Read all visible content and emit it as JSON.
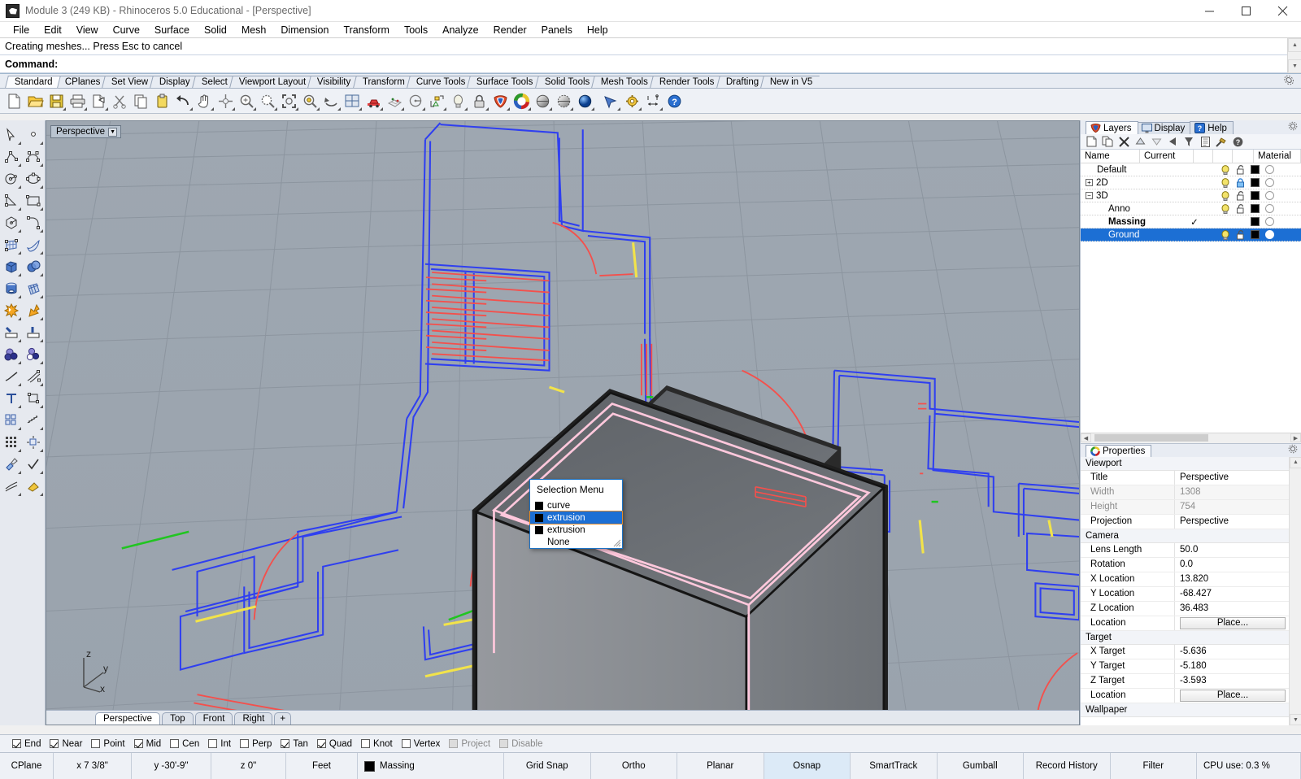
{
  "window": {
    "title": "Module 3 (249 KB) - Rhinoceros 5.0 Educational - [Perspective]",
    "minimize": "–",
    "maximize": "□",
    "close": "✕"
  },
  "menubar": [
    "File",
    "Edit",
    "View",
    "Curve",
    "Surface",
    "Solid",
    "Mesh",
    "Dimension",
    "Transform",
    "Tools",
    "Analyze",
    "Render",
    "Panels",
    "Help"
  ],
  "command": {
    "history": "Creating meshes... Press Esc to cancel",
    "prompt": "Command:"
  },
  "toolbar_tabs": [
    {
      "label": "Standard",
      "active": true
    },
    {
      "label": "CPlanes",
      "active": false
    },
    {
      "label": "Set View",
      "active": false
    },
    {
      "label": "Display",
      "active": false
    },
    {
      "label": "Select",
      "active": false
    },
    {
      "label": "Viewport Layout",
      "active": false
    },
    {
      "label": "Visibility",
      "active": false
    },
    {
      "label": "Transform",
      "active": false
    },
    {
      "label": "Curve Tools",
      "active": false
    },
    {
      "label": "Surface Tools",
      "active": false
    },
    {
      "label": "Solid Tools",
      "active": false
    },
    {
      "label": "Mesh Tools",
      "active": false
    },
    {
      "label": "Render Tools",
      "active": false
    },
    {
      "label": "Drafting",
      "active": false
    },
    {
      "label": "New in V5",
      "active": false
    }
  ],
  "viewport": {
    "label": "Perspective",
    "tabs": [
      {
        "label": "Perspective",
        "active": true
      },
      {
        "label": "Top",
        "active": false
      },
      {
        "label": "Front",
        "active": false
      },
      {
        "label": "Right",
        "active": false
      }
    ],
    "add_tab": "+",
    "axis": {
      "x": "x",
      "y": "y",
      "z": "z"
    }
  },
  "selection_menu": {
    "title": "Selection Menu",
    "items": [
      {
        "label": "curve",
        "selected": false,
        "swatch": true
      },
      {
        "label": "extrusion",
        "selected": true,
        "swatch": true
      },
      {
        "label": "extrusion",
        "selected": false,
        "swatch": true
      },
      {
        "label": "None",
        "selected": false,
        "swatch": false
      }
    ]
  },
  "panels": {
    "tabs": [
      {
        "label": "Layers",
        "active": true,
        "icon": "rhino-layers-icon"
      },
      {
        "label": "Display",
        "active": false,
        "icon": "monitor-icon"
      },
      {
        "label": "Help",
        "active": false,
        "icon": "help-icon"
      }
    ],
    "layers": {
      "columns": [
        "Name",
        "Current",
        "",
        "",
        "",
        "Material"
      ],
      "rows": [
        {
          "name": "Default",
          "indent": 1,
          "expander": "",
          "current": "",
          "bulb": true,
          "lock": "unlocked",
          "color": "#000000",
          "material": "#ffffff",
          "selected": false,
          "bold": false
        },
        {
          "name": "2D",
          "indent": 0,
          "expander": "+",
          "current": "",
          "bulb": true,
          "lock": "locked",
          "color": "#000000",
          "material": "#ffffff",
          "selected": false,
          "bold": false
        },
        {
          "name": "3D",
          "indent": 0,
          "expander": "−",
          "current": "",
          "bulb": true,
          "lock": "unlocked",
          "color": "#000000",
          "material": "#ffffff",
          "selected": false,
          "bold": false
        },
        {
          "name": "Anno",
          "indent": 2,
          "expander": "",
          "current": "",
          "bulb": true,
          "lock": "unlocked",
          "color": "#000000",
          "material": "#ffffff",
          "selected": false,
          "bold": false
        },
        {
          "name": "Massing",
          "indent": 2,
          "expander": "",
          "current": "✓",
          "bulb": false,
          "lock": "none",
          "color": "#000000",
          "material": "#ffffff",
          "selected": false,
          "bold": true
        },
        {
          "name": "Ground",
          "indent": 2,
          "expander": "",
          "current": "",
          "bulb": true,
          "lock": "unlocked",
          "color": "#000000",
          "material": "#ffffff",
          "selected": true,
          "bold": false
        }
      ]
    },
    "properties": {
      "tab_label": "Properties",
      "groups": [
        {
          "title": "Viewport",
          "rows": [
            {
              "key": "Title",
              "value": "Perspective",
              "dim": false,
              "type": "text"
            },
            {
              "key": "Width",
              "value": "1308",
              "dim": true,
              "type": "text"
            },
            {
              "key": "Height",
              "value": "754",
              "dim": true,
              "type": "text"
            },
            {
              "key": "Projection",
              "value": "Perspective",
              "dim": false,
              "type": "combo"
            }
          ]
        },
        {
          "title": "Camera",
          "rows": [
            {
              "key": "Lens Length",
              "value": "50.0",
              "dim": false,
              "type": "text"
            },
            {
              "key": "Rotation",
              "value": "0.0",
              "dim": false,
              "type": "text"
            },
            {
              "key": "X Location",
              "value": "13.820",
              "dim": false,
              "type": "text"
            },
            {
              "key": "Y Location",
              "value": "-68.427",
              "dim": false,
              "type": "text"
            },
            {
              "key": "Z Location",
              "value": "36.483",
              "dim": false,
              "type": "text"
            },
            {
              "key": "Location",
              "value": "Place...",
              "dim": false,
              "type": "button"
            }
          ]
        },
        {
          "title": "Target",
          "rows": [
            {
              "key": "X Target",
              "value": "-5.636",
              "dim": false,
              "type": "text"
            },
            {
              "key": "Y Target",
              "value": "-5.180",
              "dim": false,
              "type": "text"
            },
            {
              "key": "Z Target",
              "value": "-3.593",
              "dim": false,
              "type": "text"
            },
            {
              "key": "Location",
              "value": "Place...",
              "dim": false,
              "type": "button"
            }
          ]
        },
        {
          "title": "Wallpaper",
          "rows": []
        }
      ]
    }
  },
  "osnap": [
    {
      "label": "End",
      "checked": true,
      "disabled": false
    },
    {
      "label": "Near",
      "checked": true,
      "disabled": false
    },
    {
      "label": "Point",
      "checked": false,
      "disabled": false
    },
    {
      "label": "Mid",
      "checked": true,
      "disabled": false
    },
    {
      "label": "Cen",
      "checked": false,
      "disabled": false
    },
    {
      "label": "Int",
      "checked": false,
      "disabled": false
    },
    {
      "label": "Perp",
      "checked": false,
      "disabled": false
    },
    {
      "label": "Tan",
      "checked": true,
      "disabled": false
    },
    {
      "label": "Quad",
      "checked": true,
      "disabled": false
    },
    {
      "label": "Knot",
      "checked": false,
      "disabled": false
    },
    {
      "label": "Vertex",
      "checked": false,
      "disabled": false
    },
    {
      "label": "Project",
      "checked": false,
      "disabled": true
    },
    {
      "label": "Disable",
      "checked": false,
      "disabled": true
    }
  ],
  "statusbar": {
    "cplane": "CPlane",
    "x": "x 7 3/8\"",
    "y": "y -30'-9\"",
    "z": "z 0\"",
    "units": "Feet",
    "layer": "Massing",
    "layer_color": "#000000",
    "toggles": [
      {
        "label": "Grid Snap",
        "active": false
      },
      {
        "label": "Ortho",
        "active": false
      },
      {
        "label": "Planar",
        "active": false
      },
      {
        "label": "Osnap",
        "active": true
      },
      {
        "label": "SmartTrack",
        "active": false
      },
      {
        "label": "Gumball",
        "active": false
      },
      {
        "label": "Record History",
        "active": false
      },
      {
        "label": "Filter",
        "active": false
      }
    ],
    "cpu": "CPU use: 0.3 %"
  },
  "colors": {
    "viewport_bg": "#9aa3ad",
    "grid_line": "#8e98a3",
    "wall_blue": "#2f3ff0",
    "stair_red": "#f4504c",
    "accent_yellow": "#f2e34a",
    "accent_green": "#21c521",
    "selection_pink": "#ffc8dc",
    "highlight_blue": "#1c6fd4",
    "box_top": "#6b6f74",
    "box_front": "#8b8f94",
    "box_side": "#7d8186"
  }
}
